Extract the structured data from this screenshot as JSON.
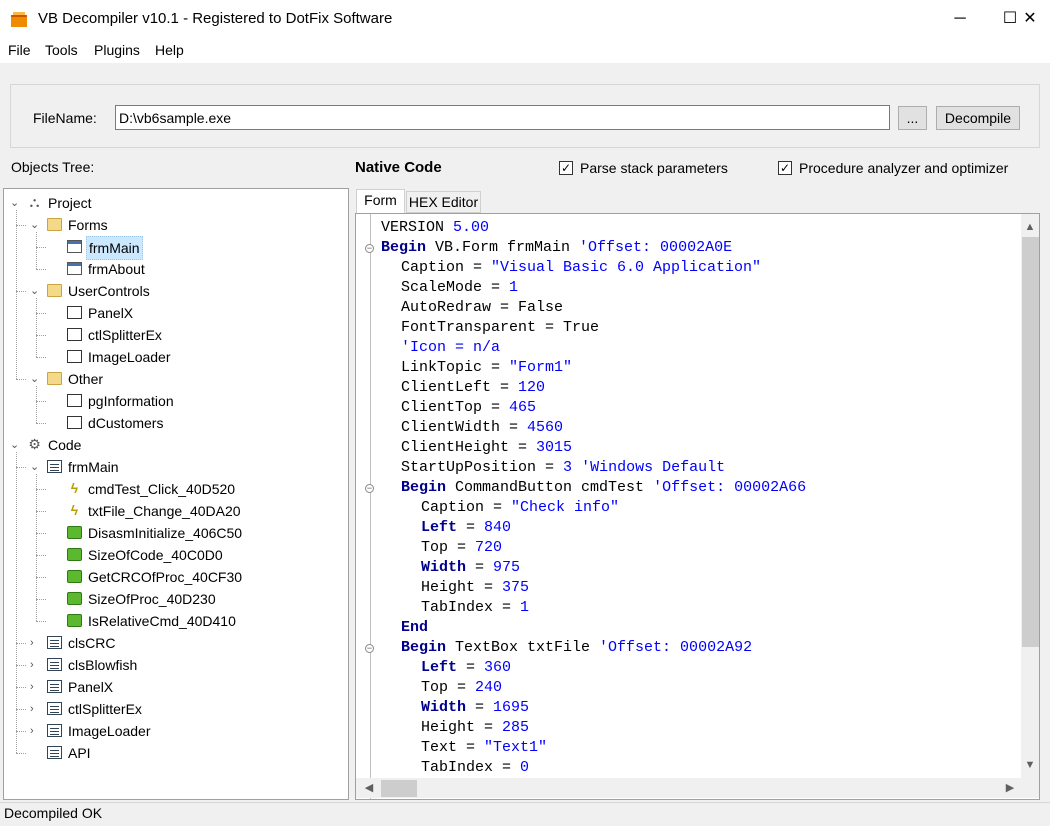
{
  "window": {
    "title": "VB Decompiler v10.1 - Registered to DotFix Software",
    "controls": [
      "─",
      "☐",
      "✕"
    ]
  },
  "menu": [
    "File",
    "Tools",
    "Plugins",
    "Help"
  ],
  "file": {
    "label": "FileName:",
    "value": "D:\\vb6sample.exe",
    "browse_label": "...",
    "decompile_label": "Decompile"
  },
  "objects_tree_label": "Objects Tree:",
  "native_code_label": "Native Code",
  "options": [
    {
      "label": "Parse stack parameters",
      "checked": true
    },
    {
      "label": "Procedure analyzer and optimizer",
      "checked": true
    }
  ],
  "tree": [
    {
      "label": "Project",
      "icon": "project-icon",
      "depth": 0,
      "expander": "expanded"
    },
    {
      "label": "Forms",
      "icon": "folder-icon",
      "depth": 1,
      "expander": "expanded"
    },
    {
      "label": "frmMain",
      "icon": "form-icon",
      "depth": 2,
      "expander": "none",
      "selected": true
    },
    {
      "label": "frmAbout",
      "icon": "form-icon",
      "depth": 2,
      "expander": "none"
    },
    {
      "label": "UserControls",
      "icon": "folder-icon",
      "depth": 1,
      "expander": "expanded"
    },
    {
      "label": "PanelX",
      "icon": "usercontrol-icon",
      "depth": 2,
      "expander": "none"
    },
    {
      "label": "ctlSplitterEx",
      "icon": "usercontrol-icon",
      "depth": 2,
      "expander": "none"
    },
    {
      "label": "ImageLoader",
      "icon": "usercontrol-icon",
      "depth": 2,
      "expander": "none"
    },
    {
      "label": "Other",
      "icon": "folder-icon",
      "depth": 1,
      "expander": "expanded"
    },
    {
      "label": "pgInformation",
      "icon": "propertypage-icon",
      "depth": 2,
      "expander": "none"
    },
    {
      "label": "dCustomers",
      "icon": "dataenv-icon",
      "depth": 2,
      "expander": "none"
    },
    {
      "label": "Code",
      "icon": "code-icon",
      "depth": 0,
      "expander": "expanded"
    },
    {
      "label": "frmMain",
      "icon": "module-icon",
      "depth": 1,
      "expander": "expanded"
    },
    {
      "label": "cmdTest_Click_40D520",
      "icon": "event-icon",
      "depth": 2,
      "expander": "none"
    },
    {
      "label": "txtFile_Change_40DA20",
      "icon": "event-icon",
      "depth": 2,
      "expander": "none"
    },
    {
      "label": "DisasmInitialize_406C50",
      "icon": "procedure-icon",
      "depth": 2,
      "expander": "none"
    },
    {
      "label": "SizeOfCode_40C0D0",
      "icon": "procedure-icon",
      "depth": 2,
      "expander": "none"
    },
    {
      "label": "GetCRCOfProc_40CF30",
      "icon": "procedure-icon",
      "depth": 2,
      "expander": "none"
    },
    {
      "label": "SizeOfProc_40D230",
      "icon": "procedure-icon",
      "depth": 2,
      "expander": "none"
    },
    {
      "label": "IsRelativeCmd_40D410",
      "icon": "procedure-icon",
      "depth": 2,
      "expander": "none"
    },
    {
      "label": "clsCRC",
      "icon": "module-icon",
      "depth": 1,
      "expander": "collapsed"
    },
    {
      "label": "clsBlowfish",
      "icon": "module-icon",
      "depth": 1,
      "expander": "collapsed"
    },
    {
      "label": "PanelX",
      "icon": "module-icon",
      "depth": 1,
      "expander": "collapsed"
    },
    {
      "label": "ctlSplitterEx",
      "icon": "module-icon",
      "depth": 1,
      "expander": "collapsed"
    },
    {
      "label": "ImageLoader",
      "icon": "module-icon",
      "depth": 1,
      "expander": "collapsed"
    },
    {
      "label": "API",
      "icon": "api-icon",
      "depth": 1,
      "expander": "none"
    }
  ],
  "tabs": [
    {
      "label": "Form",
      "active": true
    },
    {
      "label": "HEX Editor",
      "active": false
    }
  ],
  "code": [
    {
      "indent": 0,
      "fold": "",
      "parts": [
        [
          "p",
          "VERSION "
        ],
        [
          "n",
          "5.00"
        ]
      ]
    },
    {
      "indent": 0,
      "fold": "minus",
      "parts": [
        [
          "k",
          "Begin"
        ],
        [
          "p",
          " VB.Form frmMain "
        ],
        [
          "c",
          "'Offset: 00002A0E"
        ]
      ]
    },
    {
      "indent": 1,
      "fold": "",
      "parts": [
        [
          "p",
          "Caption = "
        ],
        [
          "s",
          "\"Visual Basic 6.0 Application\""
        ]
      ]
    },
    {
      "indent": 1,
      "fold": "",
      "parts": [
        [
          "p",
          "ScaleMode = "
        ],
        [
          "n",
          "1"
        ]
      ]
    },
    {
      "indent": 1,
      "fold": "",
      "parts": [
        [
          "p",
          "AutoRedraw = False"
        ]
      ]
    },
    {
      "indent": 1,
      "fold": "",
      "parts": [
        [
          "p",
          "FontTransparent = True"
        ]
      ]
    },
    {
      "indent": 1,
      "fold": "",
      "parts": [
        [
          "c",
          "'Icon = n/a"
        ]
      ]
    },
    {
      "indent": 1,
      "fold": "",
      "parts": [
        [
          "p",
          "LinkTopic = "
        ],
        [
          "s",
          "\"Form1\""
        ]
      ]
    },
    {
      "indent": 1,
      "fold": "",
      "parts": [
        [
          "p",
          "ClientLeft = "
        ],
        [
          "n",
          "120"
        ]
      ]
    },
    {
      "indent": 1,
      "fold": "",
      "parts": [
        [
          "p",
          "ClientTop = "
        ],
        [
          "n",
          "465"
        ]
      ]
    },
    {
      "indent": 1,
      "fold": "",
      "parts": [
        [
          "p",
          "ClientWidth = "
        ],
        [
          "n",
          "4560"
        ]
      ]
    },
    {
      "indent": 1,
      "fold": "",
      "parts": [
        [
          "p",
          "ClientHeight = "
        ],
        [
          "n",
          "3015"
        ]
      ]
    },
    {
      "indent": 1,
      "fold": "",
      "parts": [
        [
          "p",
          "StartUpPosition = "
        ],
        [
          "n",
          "3"
        ],
        [
          "p",
          " "
        ],
        [
          "c",
          "'Windows Default"
        ]
      ]
    },
    {
      "indent": 1,
      "fold": "minus",
      "parts": [
        [
          "k",
          "Begin"
        ],
        [
          "p",
          " CommandButton cmdTest "
        ],
        [
          "c",
          "'Offset: 00002A66"
        ]
      ]
    },
    {
      "indent": 2,
      "fold": "",
      "parts": [
        [
          "p",
          "Caption = "
        ],
        [
          "s",
          "\"Check info\""
        ]
      ]
    },
    {
      "indent": 2,
      "fold": "",
      "parts": [
        [
          "k",
          "Left"
        ],
        [
          "p",
          " = "
        ],
        [
          "n",
          "840"
        ]
      ]
    },
    {
      "indent": 2,
      "fold": "",
      "parts": [
        [
          "p",
          "Top = "
        ],
        [
          "n",
          "720"
        ]
      ]
    },
    {
      "indent": 2,
      "fold": "",
      "parts": [
        [
          "k",
          "Width"
        ],
        [
          "p",
          " = "
        ],
        [
          "n",
          "975"
        ]
      ]
    },
    {
      "indent": 2,
      "fold": "",
      "parts": [
        [
          "p",
          "Height = "
        ],
        [
          "n",
          "375"
        ]
      ]
    },
    {
      "indent": 2,
      "fold": "",
      "parts": [
        [
          "p",
          "TabIndex = "
        ],
        [
          "n",
          "1"
        ]
      ]
    },
    {
      "indent": 1,
      "fold": "",
      "parts": [
        [
          "k",
          "End"
        ]
      ]
    },
    {
      "indent": 1,
      "fold": "minus",
      "parts": [
        [
          "k",
          "Begin"
        ],
        [
          "p",
          " TextBox txtFile "
        ],
        [
          "c",
          "'Offset: 00002A92"
        ]
      ]
    },
    {
      "indent": 2,
      "fold": "",
      "parts": [
        [
          "k",
          "Left"
        ],
        [
          "p",
          " = "
        ],
        [
          "n",
          "360"
        ]
      ]
    },
    {
      "indent": 2,
      "fold": "",
      "parts": [
        [
          "p",
          "Top = "
        ],
        [
          "n",
          "240"
        ]
      ]
    },
    {
      "indent": 2,
      "fold": "",
      "parts": [
        [
          "k",
          "Width"
        ],
        [
          "p",
          " = "
        ],
        [
          "n",
          "1695"
        ]
      ]
    },
    {
      "indent": 2,
      "fold": "",
      "parts": [
        [
          "p",
          "Height = "
        ],
        [
          "n",
          "285"
        ]
      ]
    },
    {
      "indent": 2,
      "fold": "",
      "parts": [
        [
          "p",
          "Text = "
        ],
        [
          "s",
          "\"Text1\""
        ]
      ]
    },
    {
      "indent": 2,
      "fold": "",
      "parts": [
        [
          "p",
          "TabIndex = "
        ],
        [
          "n",
          "0"
        ]
      ]
    }
  ],
  "status": "Decompiled OK"
}
